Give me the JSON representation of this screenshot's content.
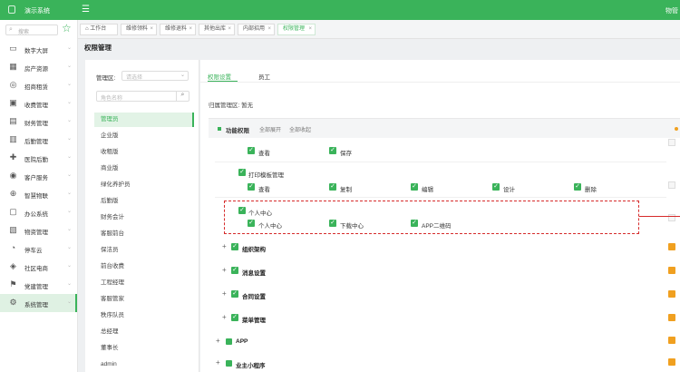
{
  "header": {
    "app_title": "演示系统",
    "user": "物管"
  },
  "sidebar": {
    "search_placeholder": "搜索",
    "items": [
      {
        "label": "数字大屏",
        "icon": "monitor-icon"
      },
      {
        "label": "房产资源",
        "icon": "building-icon"
      },
      {
        "label": "招商租赁",
        "icon": "handshake-icon"
      },
      {
        "label": "收费管理",
        "icon": "money-icon"
      },
      {
        "label": "财务管理",
        "icon": "finance-icon"
      },
      {
        "label": "后勤管理",
        "icon": "logistics-icon"
      },
      {
        "label": "医院后勤",
        "icon": "hospital-icon"
      },
      {
        "label": "客户服务",
        "icon": "customer-icon"
      },
      {
        "label": "智慧物联",
        "icon": "iot-icon"
      },
      {
        "label": "办公系统",
        "icon": "office-icon"
      },
      {
        "label": "物资管理",
        "icon": "box-icon"
      },
      {
        "label": "停车云",
        "icon": "parking-icon"
      },
      {
        "label": "社区电商",
        "icon": "shop-icon"
      },
      {
        "label": "党建管理",
        "icon": "flag-icon"
      },
      {
        "label": "系统管理",
        "icon": "gear-icon"
      }
    ]
  },
  "tabs": [
    {
      "label": "工作台"
    },
    {
      "label": "维修领料"
    },
    {
      "label": "维修退料"
    },
    {
      "label": "其他出库"
    },
    {
      "label": "内部招用"
    },
    {
      "label": "权限管理"
    }
  ],
  "page_title": "权限管理",
  "left_panel": {
    "area_label": "管理区:",
    "area_placeholder": "请选择",
    "role_search_placeholder": "角色名称",
    "roles": [
      "管理员",
      "企业版",
      "收租版",
      "商业版",
      "绿化养护员",
      "后勤版",
      "财务会计",
      "客服前台",
      "保洁员",
      "前台收费",
      "工程经理",
      "客服管家",
      "秩序队员",
      "总经理",
      "董事长",
      "admin"
    ]
  },
  "right_panel": {
    "tabs": [
      "权限设置",
      "员工"
    ],
    "mgmt_area": "归属管理区: 暂无",
    "header": {
      "title": "功能权限",
      "expand_all": "全部展开",
      "collapse_all": "全部收起"
    },
    "row1": [
      "查看",
      "保存"
    ],
    "print_template": {
      "label": "打印模板管理",
      "perms": [
        "查看",
        "复制",
        "编辑",
        "设计",
        "删除"
      ]
    },
    "personal_center": {
      "label": "个人中心",
      "perms": [
        "个人中心",
        "下载中心",
        "APP二维码"
      ]
    },
    "groups": [
      "组织架构",
      "消息设置",
      "合同设置",
      "菜单管理"
    ],
    "groups2": [
      "APP",
      "业主小程序"
    ]
  }
}
